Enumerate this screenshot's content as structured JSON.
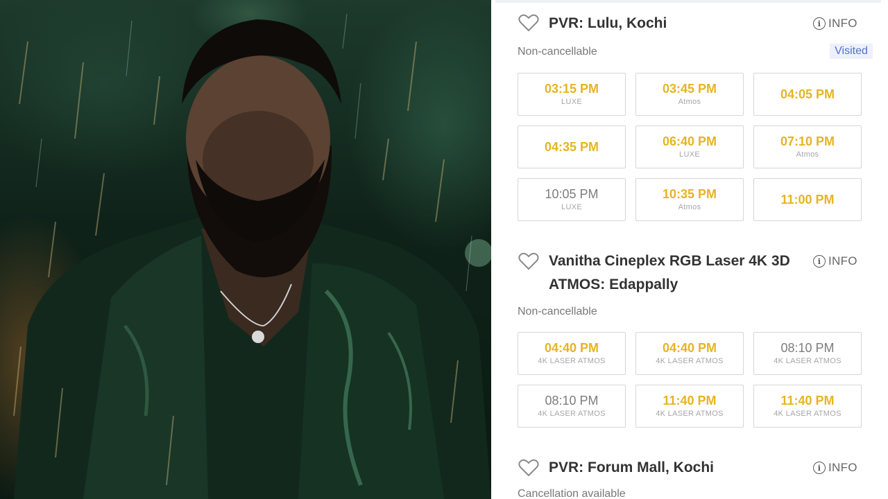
{
  "photo": {
    "alt": "Man with beard in rain, dark green shirt"
  },
  "cinemas": [
    {
      "name": "PVR: Lulu, Kochi",
      "info_label": "INFO",
      "policy": "Non-cancellable",
      "badge": "Visited",
      "showtimes": [
        {
          "time": "03:15 PM",
          "format": "LUXE",
          "available": true
        },
        {
          "time": "03:45 PM",
          "format": "Atmos",
          "available": true
        },
        {
          "time": "04:05 PM",
          "format": "",
          "available": true
        },
        {
          "time": "04:35 PM",
          "format": "",
          "available": true
        },
        {
          "time": "06:40 PM",
          "format": "LUXE",
          "available": true
        },
        {
          "time": "07:10 PM",
          "format": "Atmos",
          "available": true
        },
        {
          "time": "10:05 PM",
          "format": "LUXE",
          "available": false
        },
        {
          "time": "10:35 PM",
          "format": "Atmos",
          "available": true
        },
        {
          "time": "11:00 PM",
          "format": "",
          "available": true
        }
      ]
    },
    {
      "name_line1": "Vanitha Cineplex RGB Laser 4K 3D",
      "name_line2": "ATMOS: Edappally",
      "info_label": "INFO",
      "policy": "Non-cancellable",
      "showtimes": [
        {
          "time": "04:40 PM",
          "format": "4K LASER ATMOS",
          "available": true
        },
        {
          "time": "04:40 PM",
          "format": "4K LASER ATMOS",
          "available": true
        },
        {
          "time": "08:10 PM",
          "format": "4K LASER ATMOS",
          "available": false
        },
        {
          "time": "08:10 PM",
          "format": "4K LASER ATMOS",
          "available": false
        },
        {
          "time": "11:40 PM",
          "format": "4K LASER ATMOS",
          "available": true
        },
        {
          "time": "11:40 PM",
          "format": "4K LASER ATMOS",
          "available": true
        }
      ]
    },
    {
      "name": "PVR: Forum Mall, Kochi",
      "info_label": "INFO",
      "policy": "Cancellation available"
    }
  ],
  "colors": {
    "available_time": "#e6b422",
    "unavailable_time": "#7d7d7d",
    "visited_badge_bg": "#eef1fb",
    "visited_badge_text": "#5470c8"
  }
}
